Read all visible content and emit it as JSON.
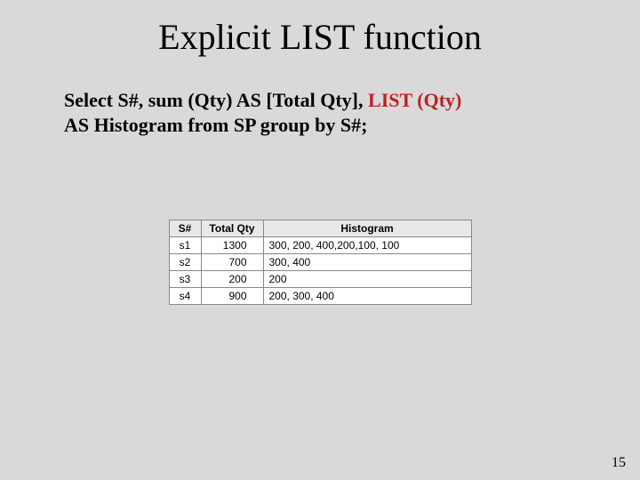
{
  "title": "Explicit LIST function",
  "sql_line1_a": "Select S#, sum (Qty) AS [Total Qty],  ",
  "sql_line1_b": "LIST (Qty)",
  "sql_line2": "AS Histogram from SP group by S#;",
  "headers": {
    "sn": "S#",
    "tq": "Total Qty",
    "hist": "Histogram"
  },
  "rows": [
    {
      "sn": "s1",
      "tq": "1300",
      "hist": "300, 200, 400,200,100, 100"
    },
    {
      "sn": "s2",
      "tq": "700",
      "hist": "300, 400"
    },
    {
      "sn": "s3",
      "tq": "200",
      "hist": "200"
    },
    {
      "sn": "s4",
      "tq": "900",
      "hist": "200, 300, 400"
    }
  ],
  "page_number": "15"
}
